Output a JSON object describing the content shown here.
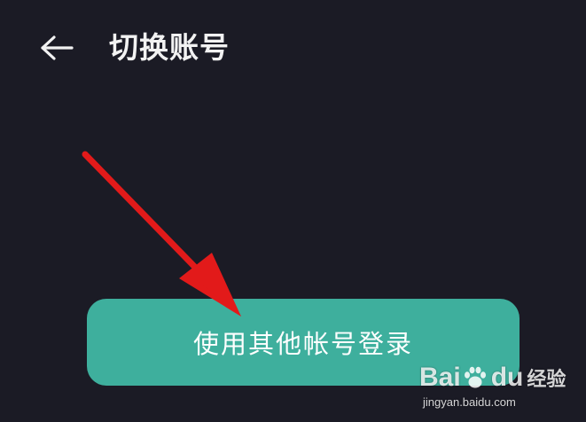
{
  "header": {
    "back_icon": "arrow-left-icon",
    "title": "切换账号"
  },
  "main": {
    "login_button_label": "使用其他帐号登录"
  },
  "annotation": {
    "arrow_icon": "red-arrow-icon",
    "arrow_color": "#e21a1a"
  },
  "watermark": {
    "brand_prefix": "Bai",
    "brand_suffix": "du",
    "brand_cn": "经验",
    "url": "jingyan.baidu.com"
  },
  "colors": {
    "background": "#1b1b25",
    "button": "#3eaf9d",
    "title_text": "#f2f2f2"
  }
}
